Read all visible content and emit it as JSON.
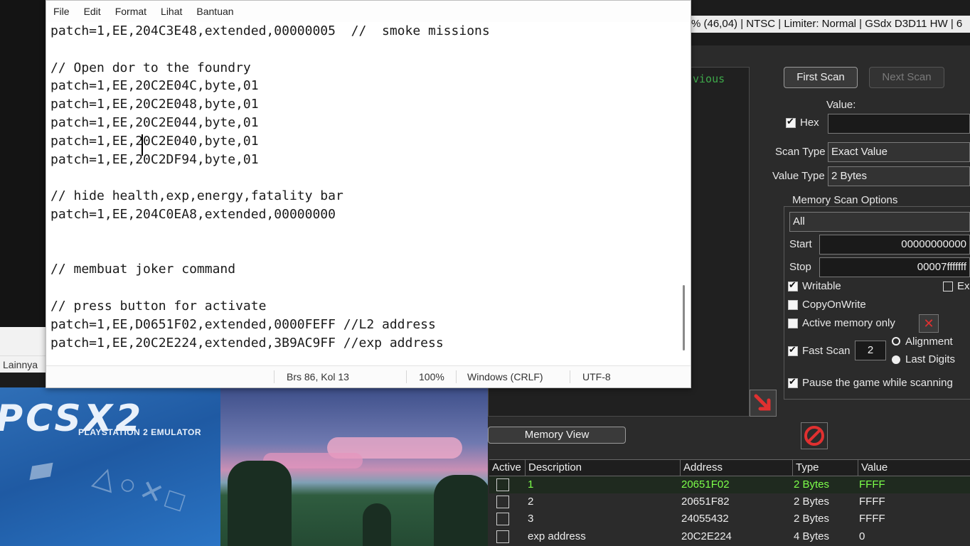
{
  "notepad": {
    "menu": [
      "File",
      "Edit",
      "Format",
      "Lihat",
      "Bantuan"
    ],
    "lines": [
      "patch=1,EE,204C3E48,extended,00000005  //  smoke missions",
      "",
      "// Open dor to the foundry",
      "patch=1,EE,20C2E04C,byte,01",
      "patch=1,EE,20C2E048,byte,01",
      "patch=1,EE,20C2E044,byte,01",
      "patch=1,EE,20C2E040,byte,01",
      "patch=1,EE,20C2DF94,byte,01",
      "",
      "// hide health,exp,energy,fatality bar",
      "patch=1,EE,204C0EA8,extended,00000000",
      "",
      "",
      "// membuat joker command",
      "",
      "// press button for activate",
      "patch=1,EE,D0651F02,extended,0000FEFF //L2 address",
      "patch=1,EE,20C2E224,extended,3B9AC9FF //exp address"
    ],
    "status": {
      "position": "Brs 86, Kol 13",
      "zoom": "100%",
      "line_ending": "Windows (CRLF)",
      "encoding": "UTF-8"
    }
  },
  "taskbar": {
    "lainnya": "Lainnya"
  },
  "pcsx2": {
    "logo": "PCSX2",
    "subtitle": "PLAYSTATION 2 EMULATOR"
  },
  "emulator_title": "% (46,04) | NTSC | Limiter: Normal | GSdx D3D11 HW | 6",
  "cheat_engine": {
    "previous_label": "vious",
    "first_scan": "First Scan",
    "next_scan": "Next Scan",
    "value_label": "Value:",
    "value_input": "",
    "hex_label": "Hex",
    "scan_type_label": "Scan Type",
    "scan_type_value": "Exact Value",
    "value_type_label": "Value Type",
    "value_type_value": "2 Bytes",
    "memory_scan_options": "Memory Scan Options",
    "region_value": "All",
    "start_label": "Start",
    "start_value": "00000000000",
    "stop_label": "Stop",
    "stop_value": "00007fffffff",
    "writable": "Writable",
    "executable": "Ex",
    "copy_on_write": "CopyOnWrite",
    "active_memory_only": "Active memory only",
    "fast_scan": "Fast Scan",
    "fast_scan_value": "2",
    "alignment": "Alignment",
    "last_digits": "Last Digits",
    "pause_game": "Pause the game while scanning",
    "memory_view": "Memory View",
    "table_headers": [
      "Active",
      "Description",
      "Address",
      "Type",
      "Value"
    ],
    "rows": [
      {
        "description": "1",
        "address": "20651F02",
        "type": "2 Bytes",
        "value": "FFFF",
        "highlight": true
      },
      {
        "description": "2",
        "address": "20651F82",
        "type": "2 Bytes",
        "value": "FFFF",
        "highlight": false
      },
      {
        "description": "3",
        "address": "24055432",
        "type": "2 Bytes",
        "value": "FFFF",
        "highlight": false
      },
      {
        "description": "exp address",
        "address": "20C2E224",
        "type": "4 Bytes",
        "value": "0",
        "highlight": false
      }
    ],
    "colors": {
      "highlight_text": "#7cff4a",
      "row_bg": "#2b2b2b",
      "accent_red": "#e03030"
    }
  }
}
